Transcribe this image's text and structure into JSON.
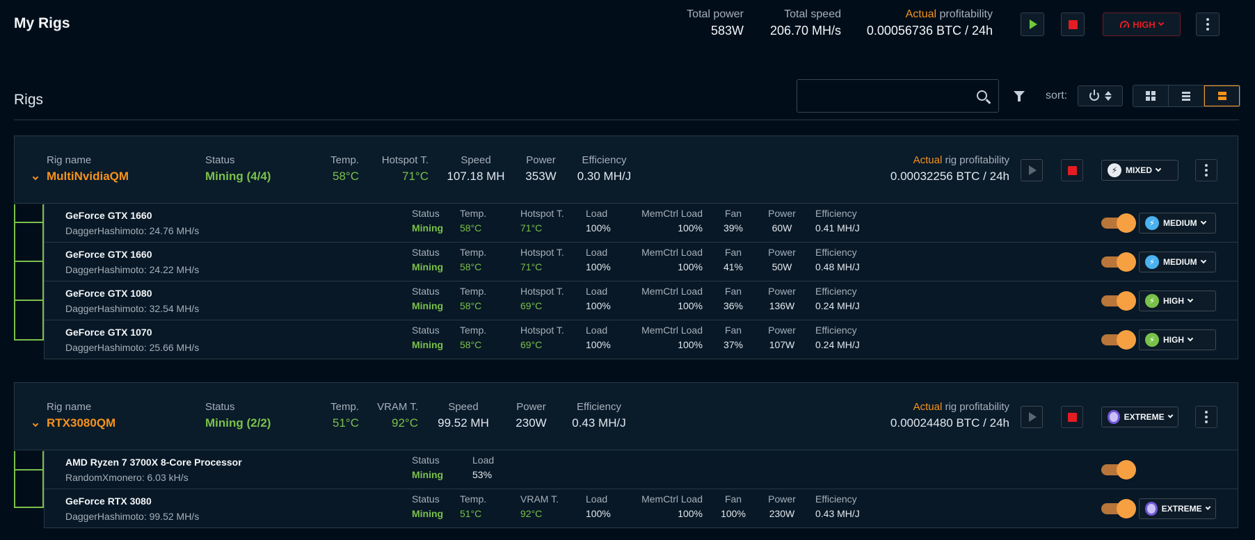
{
  "header": {
    "title": "My Rigs",
    "total_power_label": "Total power",
    "total_power": "583W",
    "total_speed_label": "Total speed",
    "total_speed": "206.70 MH/s",
    "profit_label_accent": "Actual",
    "profit_label_rest": " profitability",
    "profitability": "0.00056736 BTC / 24h",
    "mode": "HIGH"
  },
  "toolbar": {
    "section_title": "Rigs",
    "search_placeholder": "",
    "sort_label": "sort:"
  },
  "labels": {
    "rig_name": "Rig name",
    "status": "Status",
    "temp": "Temp.",
    "hotspot": "Hotspot T.",
    "vram": "VRAM T.",
    "speed": "Speed",
    "power": "Power",
    "efficiency": "Efficiency",
    "actual": "Actual",
    "rig_profitability": " rig profitability",
    "load": "Load",
    "memctrl": "MemCtrl Load",
    "fan": "Fan"
  },
  "rigs": [
    {
      "name": "MultiNvidiaQM",
      "status": "Mining (4/4)",
      "temp": "58°C",
      "hotspot": "71°C",
      "speed": "107.18 MH",
      "power": "353W",
      "efficiency": "0.30 MH/J",
      "profitability": "0.00032256 BTC / 24h",
      "mode": "MIXED",
      "devices": [
        {
          "name": "GeForce GTX 1660",
          "algo": "DaggerHashimoto: 24.76 MH/s",
          "status": "Mining",
          "temp": "58°C",
          "hotspot": "71°C",
          "load": "100%",
          "memctrl": "100%",
          "fan": "39%",
          "power": "60W",
          "efficiency": "0.41 MH/J",
          "mode": "MEDIUM"
        },
        {
          "name": "GeForce GTX 1660",
          "algo": "DaggerHashimoto: 24.22 MH/s",
          "status": "Mining",
          "temp": "58°C",
          "hotspot": "71°C",
          "load": "100%",
          "memctrl": "100%",
          "fan": "41%",
          "power": "50W",
          "efficiency": "0.48 MH/J",
          "mode": "MEDIUM"
        },
        {
          "name": "GeForce GTX 1080",
          "algo": "DaggerHashimoto: 32.54 MH/s",
          "status": "Mining",
          "temp": "58°C",
          "hotspot": "69°C",
          "load": "100%",
          "memctrl": "100%",
          "fan": "36%",
          "power": "136W",
          "efficiency": "0.24 MH/J",
          "mode": "HIGH"
        },
        {
          "name": "GeForce GTX 1070",
          "algo": "DaggerHashimoto: 25.66 MH/s",
          "status": "Mining",
          "temp": "58°C",
          "hotspot": "69°C",
          "load": "100%",
          "memctrl": "100%",
          "fan": "37%",
          "power": "107W",
          "efficiency": "0.24 MH/J",
          "mode": "HIGH"
        }
      ]
    },
    {
      "name": "RTX3080QM",
      "status": "Mining (2/2)",
      "temp": "51°C",
      "vram": "92°C",
      "speed": "99.52 MH",
      "power": "230W",
      "efficiency": "0.43 MH/J",
      "profitability": "0.00024480 BTC / 24h",
      "mode": "EXTREME",
      "devices": [
        {
          "name": "AMD Ryzen 7 3700X 8-Core Processor",
          "algo": "RandomXmonero: 6.03 kH/s",
          "status": "Mining",
          "load": "53%"
        },
        {
          "name": "GeForce RTX 3080",
          "algo": "DaggerHashimoto: 99.52 MH/s",
          "status": "Mining",
          "temp": "51°C",
          "vram": "92°C",
          "load": "100%",
          "memctrl": "100%",
          "fan": "100%",
          "power": "230W",
          "efficiency": "0.43 MH/J",
          "mode": "EXTREME"
        }
      ]
    }
  ]
}
